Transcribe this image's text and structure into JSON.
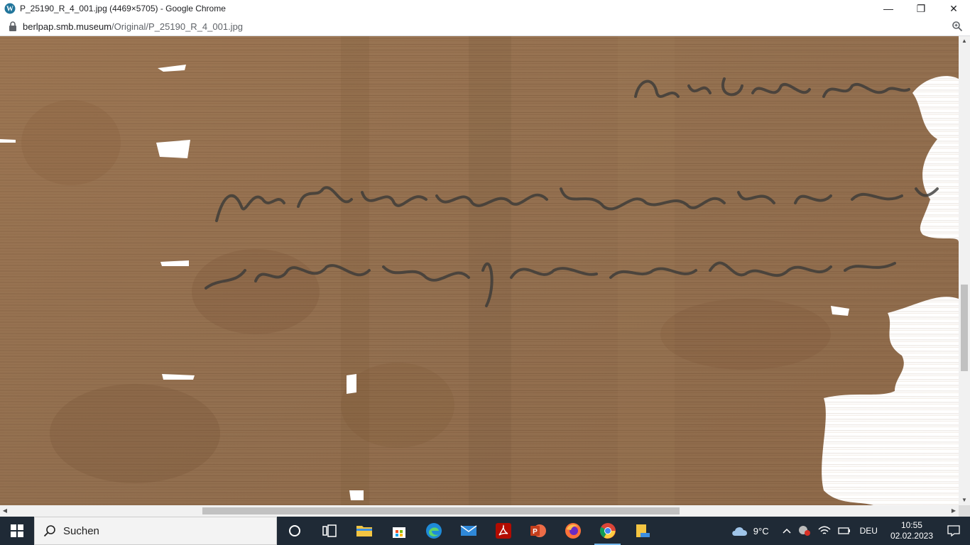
{
  "window": {
    "title": "P_25190_R_4_001.jpg (4469×5705) - Google Chrome",
    "minimize_label": "—",
    "restore_label": "❐",
    "close_label": "✕"
  },
  "address": {
    "host": "berlpap.smb.museum",
    "path": "/Original/P_25190_R_4_001.jpg"
  },
  "scrollbars": {
    "up": "▲",
    "down": "▼",
    "left": "◀",
    "right": "▶"
  },
  "taskbar": {
    "search_placeholder": "Suchen",
    "apps": [
      "cortana-icon",
      "task-view-icon",
      "file-explorer-icon",
      "store-icon",
      "edge-icon",
      "mail-icon",
      "acrobat-icon",
      "powerpoint-icon",
      "firefox-icon",
      "chrome-icon",
      "folder-icon"
    ],
    "weather": {
      "temp": "9°C",
      "icon": "cloud-icon"
    },
    "language": "DEU",
    "time": "10:55",
    "date": "02.02.2023"
  },
  "colors": {
    "papyrus": "#9a7451",
    "ink": "#3a3a38",
    "taskbar": "#1f2a36"
  }
}
